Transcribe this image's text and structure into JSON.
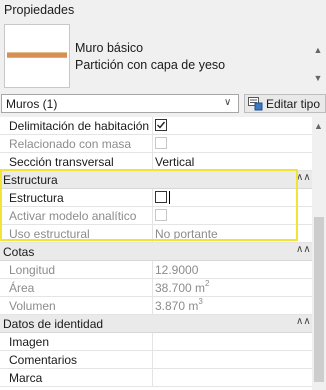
{
  "panel": {
    "title": "Propiedades"
  },
  "type_selector": {
    "family": "Muro básico",
    "type": "Partición con capa de yeso",
    "scroll_up": "▲",
    "scroll_down": "▼"
  },
  "filter": {
    "selected": "Muros (1)",
    "chevron": "∨",
    "edit_type_label": "Editar tipo"
  },
  "properties": {
    "rows": [
      {
        "name": "Delimitación de habitación",
        "checkbox": true,
        "checked": true
      },
      {
        "name": "Relacionado con masa",
        "checkbox": true,
        "checked": false,
        "dim": true
      },
      {
        "name": "Sección transversal",
        "value": "Vertical"
      }
    ],
    "groups": [
      {
        "name": "Estructura",
        "rows": [
          {
            "name": "Estructura",
            "checkbox": true,
            "checked": false,
            "active": true
          },
          {
            "name": "Activar modelo analítico",
            "checkbox": true,
            "checked": false,
            "dim": true
          },
          {
            "name": "Uso estructural",
            "value": "No portante",
            "dim": true
          }
        ]
      },
      {
        "name": "Cotas",
        "rows": [
          {
            "name": "Longitud",
            "value": "12.9000",
            "dim": true
          },
          {
            "name": "Área",
            "value": "38.700 m",
            "unit_sup": "2",
            "dim": true
          },
          {
            "name": "Volumen",
            "value": "3.870 m",
            "unit_sup": "3",
            "dim": true
          }
        ]
      },
      {
        "name": "Datos de identidad",
        "rows": [
          {
            "name": "Imagen",
            "value": ""
          },
          {
            "name": "Comentarios",
            "value": ""
          },
          {
            "name": "Marca",
            "value": ""
          }
        ]
      }
    ],
    "collapse_glyph": "∧∧"
  },
  "colors": {
    "highlight": "#f2e437",
    "group_bg": "#eaeaea",
    "dim_text": "#8c8c8c"
  }
}
